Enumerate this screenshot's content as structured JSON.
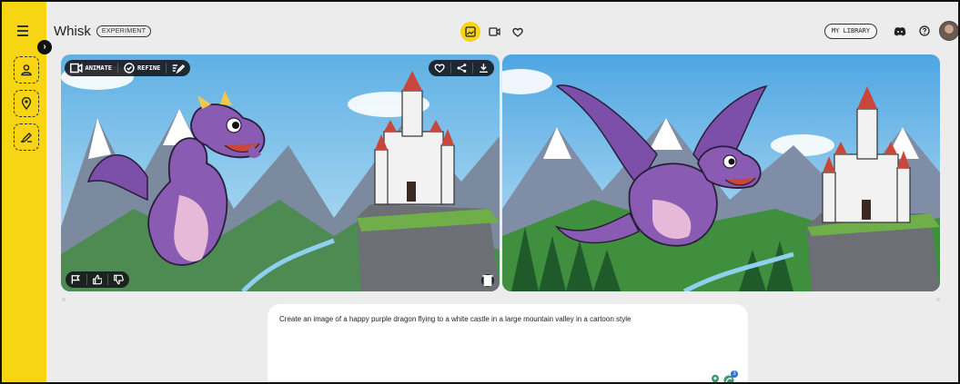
{
  "header": {
    "app_title": "Whisk",
    "badge": "EXPERIMENT",
    "library_button": "MY LIBRARY"
  },
  "sidebar": {
    "slots": [
      {
        "icon": "person-icon",
        "role": "subject"
      },
      {
        "icon": "location-pin-icon",
        "role": "scene"
      },
      {
        "icon": "brush-icon",
        "role": "style"
      }
    ]
  },
  "center_tools": [
    {
      "icon": "image-icon",
      "active": true
    },
    {
      "icon": "video-icon",
      "active": false
    },
    {
      "icon": "heart-icon",
      "active": false
    }
  ],
  "image_left": {
    "actions": {
      "animate": "ANIMATE",
      "refine": "REFINE"
    }
  },
  "prompt": {
    "text": "Create an image of a happy purple dragon flying to a white castle in a large mountain valley in a cartoon style",
    "badge_count": "3"
  },
  "colors": {
    "accent": "#f7d414",
    "background": "#ececec",
    "toolbar": "#14141a",
    "dragon": "#8a5bb3",
    "sky": "#7fc3ea"
  }
}
